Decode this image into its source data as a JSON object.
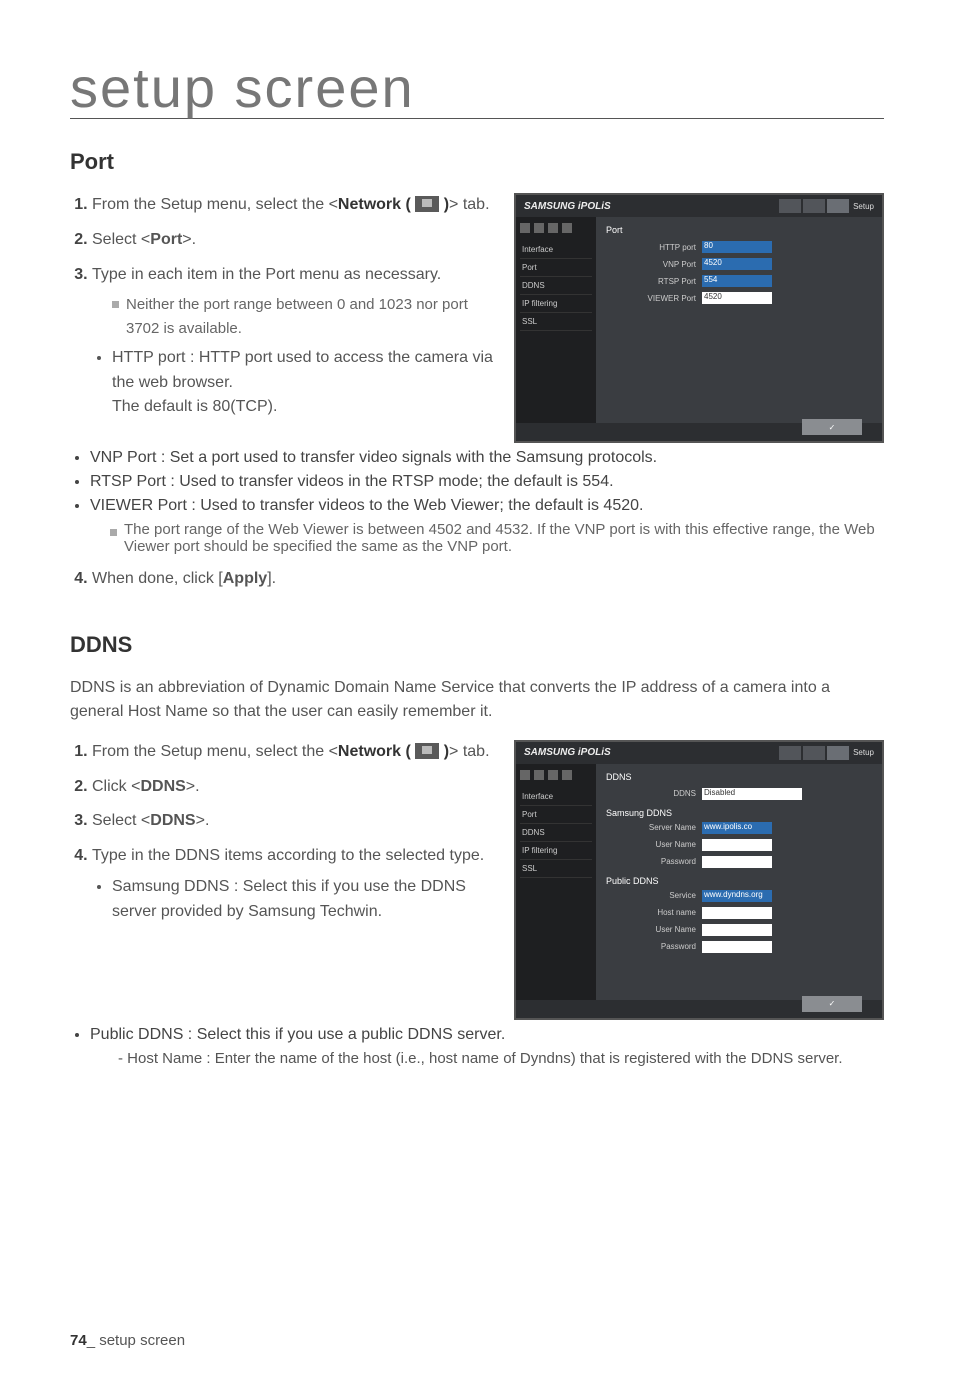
{
  "page_title": "setup screen",
  "section1": {
    "heading": "Port",
    "step1": "From the Setup menu, select the ",
    "step1_tab_pre": "<",
    "step1_tab_bold": "Network ( ",
    "step1_tab_post": " )",
    "step1_tab_close": "> tab.",
    "step2_pre": "Select <",
    "step2_bold": "Port",
    "step2_post": ">.",
    "step3": "Type in each item in the Port menu as necessary.",
    "step3_note": "Neither the port range between 0 and 1023 nor port 3702 is available.",
    "step3_bullet1a": "HTTP port : HTTP port used to access the camera via the web browser.",
    "step3_bullet1b": "The default is 80(TCP).",
    "full_bullet1": "VNP Port : Set a port used to transfer video signals with the Samsung protocols.",
    "full_bullet2": "RTSP Port : Used to transfer videos in the RTSP mode; the default is 554.",
    "full_bullet3": "VIEWER Port : Used to transfer videos to the Web Viewer; the default is 4520.",
    "full_bullet3_note": "The port range of the Web Viewer is between 4502 and 4532. If the VNP port is with this effective range, the Web Viewer port should be specified the same as the VNP port.",
    "step4_pre": "When done, click [",
    "step4_bold": "Apply",
    "step4_post": "]."
  },
  "section2": {
    "heading": "DDNS",
    "intro": "DDNS is an abbreviation of Dynamic Domain Name Service that converts the IP address of a camera into a general Host Name so that the user can easily remember it.",
    "step1": "From the Setup menu, select the ",
    "step1_tab_pre": "<",
    "step1_tab_bold": "Network ( ",
    "step1_tab_post": " )",
    "step1_tab_close": "> tab.",
    "step2_pre": "Click <",
    "step2_bold": "DDNS",
    "step2_post": ">.",
    "step3_pre": "Select <",
    "step3_bold": "DDNS",
    "step3_post": ">.",
    "step4": "Type in the DDNS items according to the selected type.",
    "step4_bullet1": "Samsung DDNS : Select this if you use the DDNS server provided by Samsung Techwin.",
    "full_bullet1": "Public DDNS : Select this if you use a public DDNS server.",
    "full_bullet1_dash": "Host Name : Enter the name of the host (i.e., host name of Dyndns) that is registered with the DDNS server."
  },
  "shot1": {
    "logo": "SAMSUNG iPOLiS",
    "setup": "Setup",
    "panel_title": "Port",
    "side_items": [
      "Interface",
      "Port",
      "DDNS",
      "IP filtering",
      "SSL"
    ],
    "rows": [
      {
        "label": "HTTP port",
        "value": "80",
        "blue": true
      },
      {
        "label": "VNP Port",
        "value": "4520",
        "blue": true
      },
      {
        "label": "RTSP Port",
        "value": "554",
        "blue": true
      },
      {
        "label": "VIEWER Port",
        "value": "4520",
        "blue": false
      }
    ],
    "apply": "✓"
  },
  "shot2": {
    "logo": "SAMSUNG iPOLiS",
    "setup": "Setup",
    "panel_title": "DDNS",
    "side_items": [
      "Interface",
      "Port",
      "DDNS",
      "IP filtering",
      "SSL"
    ],
    "ddns_label": "DDNS",
    "ddns_value": "Disabled",
    "group1": "Samsung DDNS",
    "group1_rows": [
      {
        "label": "Server Name",
        "value": "www.ipolis.co"
      },
      {
        "label": "User Name",
        "value": ""
      },
      {
        "label": "Password",
        "value": ""
      }
    ],
    "group2": "Public DDNS",
    "group2_rows": [
      {
        "label": "Service",
        "value": "www.dyndns.org"
      },
      {
        "label": "Host name",
        "value": ""
      },
      {
        "label": "User Name",
        "value": ""
      },
      {
        "label": "Password",
        "value": ""
      }
    ],
    "apply": "✓"
  },
  "footer": {
    "page_num": "74",
    "sep": "_ ",
    "label": "setup screen"
  }
}
